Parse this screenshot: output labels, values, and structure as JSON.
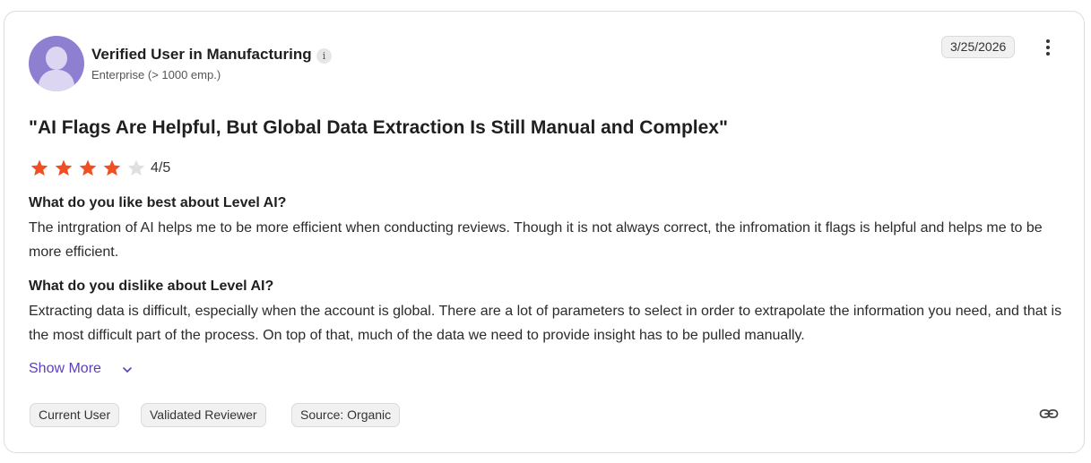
{
  "reviewer": {
    "name": "Verified User in Manufacturing",
    "info_icon": "i",
    "company_size": "Enterprise (> 1000 emp.)"
  },
  "date": "3/25/2026",
  "review": {
    "title": "\"AI Flags Are Helpful, But Global Data Extraction Is Still Manual and Complex\"",
    "rating": 4,
    "rating_max": 5,
    "rating_text": "4/5",
    "star_color": "#f04e23",
    "star_empty_color": "#e0e0e0",
    "questions": [
      {
        "label": "What do you like best about Level AI?",
        "answer": "The intrgration of AI helps me to be more efficient when conducting reviews. Though it is not always correct, the infromation it flags is helpful and helps me to be more efficient."
      },
      {
        "label": "What do you dislike about Level AI?",
        "answer": "Extracting data is difficult, especially when the account is global. There are a lot of parameters to select in order to extrapolate the information you need, and that is the most difficult part of the process. On top of that, much of the data we need to provide insight has to be pulled manually."
      }
    ]
  },
  "show_more_label": "Show More",
  "tags": [
    "Current User",
    "Validated Reviewer",
    "Source: Organic"
  ],
  "icons": {
    "avatar": "user-avatar",
    "more": "more-vertical-icon",
    "chevron": "chevron-down-icon",
    "link": "link-icon"
  },
  "accent_color": "#5b3fbe"
}
